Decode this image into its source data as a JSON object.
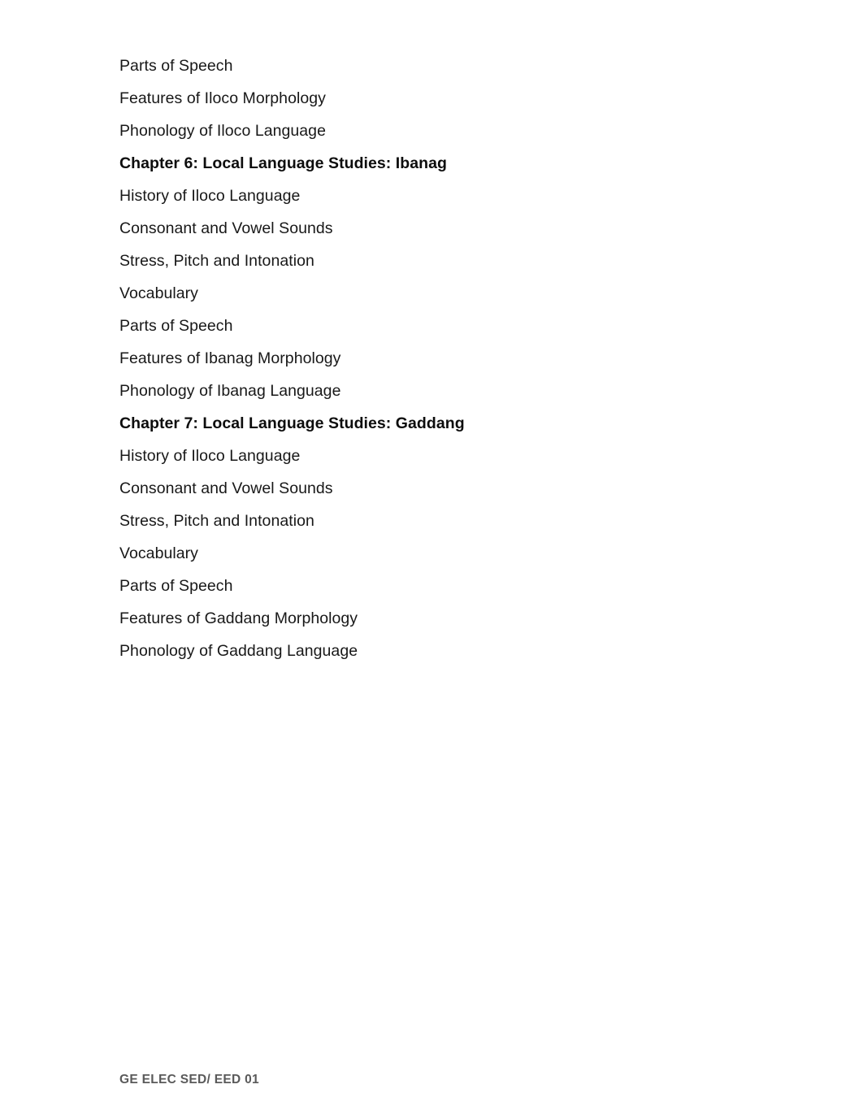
{
  "document": {
    "background_color": "#ffffff",
    "text_color": "#181818",
    "heading_color": "#0d0d0d",
    "footer_color": "#5a5a5a",
    "lines": [
      {
        "text": "Parts of Speech",
        "style": "body"
      },
      {
        "text": "Features of Iloco Morphology",
        "style": "body"
      },
      {
        "text": "Phonology of Iloco Language",
        "style": "body"
      },
      {
        "text": "Chapter 6: Local Language Studies: Ibanag",
        "style": "heading"
      },
      {
        "text": "History of Iloco Language",
        "style": "body"
      },
      {
        "text": "Consonant and Vowel Sounds",
        "style": "body"
      },
      {
        "text": "Stress, Pitch and Intonation",
        "style": "body"
      },
      {
        "text": "Vocabulary",
        "style": "body"
      },
      {
        "text": "Parts of Speech",
        "style": "body"
      },
      {
        "text": "Features of Ibanag Morphology",
        "style": "body"
      },
      {
        "text": "Phonology of Ibanag Language",
        "style": "body"
      },
      {
        "text": "Chapter 7: Local Language Studies: Gaddang",
        "style": "heading"
      },
      {
        "text": "History of Iloco Language",
        "style": "body"
      },
      {
        "text": "Consonant and Vowel Sounds",
        "style": "body"
      },
      {
        "text": "Stress, Pitch and Intonation",
        "style": "body"
      },
      {
        "text": "Vocabulary",
        "style": "body"
      },
      {
        "text": "Parts of Speech",
        "style": "body"
      },
      {
        "text": "Features of Gaddang Morphology",
        "style": "body"
      },
      {
        "text": "Phonology of Gaddang Language",
        "style": "body"
      }
    ]
  },
  "footer": {
    "course_code": "GE ELEC SED/ EED 01",
    "page_number": ""
  }
}
